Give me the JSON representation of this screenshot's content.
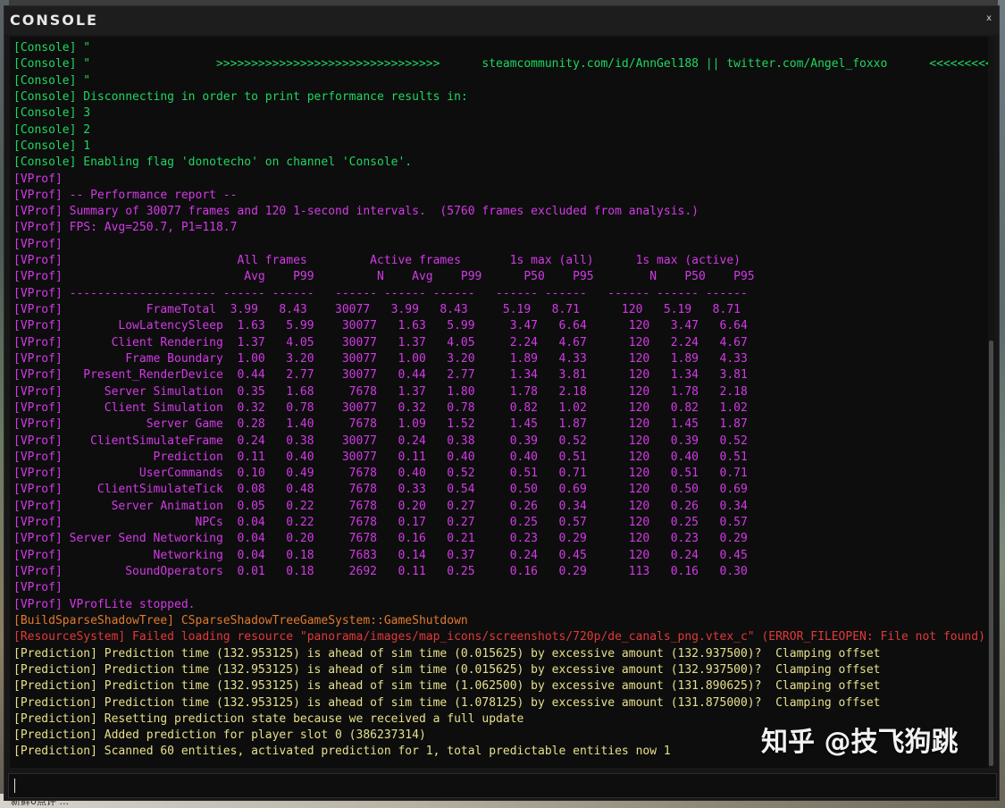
{
  "window": {
    "title": "CONSOLE",
    "close_glyph": "x"
  },
  "colors": {
    "console": "#1ed760",
    "vprof": "#d23ae6",
    "build": "#e07a2e",
    "resource": "#e03a3a",
    "prediction": "#e6e08a",
    "background": "#0d0d0d"
  },
  "log": {
    "lines": [
      {
        "channel": "console",
        "text": "[Console] \""
      },
      {
        "channel": "console",
        "text": "[Console] \"                  >>>>>>>>>>>>>>>>>>>>>>>>>>>>>>>>      steamcommunity.com/id/AnnGel188 || twitter.com/Angel_foxxo      <<<<<<<<<<<<<<<<<<<<<<<<<<<<<<<<<<"
      },
      {
        "channel": "console",
        "text": "[Console] \""
      },
      {
        "channel": "console",
        "text": "[Console] Disconnecting in order to print performance results in:"
      },
      {
        "channel": "console",
        "text": "[Console] 3"
      },
      {
        "channel": "console",
        "text": "[Console] 2"
      },
      {
        "channel": "console",
        "text": "[Console] 1"
      },
      {
        "channel": "console",
        "text": "[Console] Enabling flag 'donotecho' on channel 'Console'."
      },
      {
        "channel": "vprof",
        "text": "[VProf]"
      },
      {
        "channel": "vprof",
        "text": "[VProf] -- Performance report --"
      },
      {
        "channel": "vprof",
        "text": "[VProf] Summary of 30077 frames and 120 1-second intervals.  (5760 frames excluded from analysis.)"
      },
      {
        "channel": "vprof",
        "text": "[VProf] FPS: Avg=250.7, P1=118.7"
      },
      {
        "channel": "vprof",
        "text": "[VProf]"
      },
      {
        "channel": "vprof",
        "text": "[VProf]                         All frames         Active frames       1s max (all)      1s max (active)"
      },
      {
        "channel": "vprof",
        "text": "[VProf]                          Avg    P99         N    Avg    P99      P50    P95        N    P50    P95"
      },
      {
        "channel": "vprof",
        "text": "[VProf] --------------------- ------ ------   ------ ------ ------   ------ ------   ------ ------ ------"
      },
      {
        "channel": "vprof",
        "text": "[VProf]            FrameTotal  3.99   8.43    30077   3.99   8.43     5.19   8.71      120   5.19   8.71"
      },
      {
        "channel": "vprof",
        "text": "[VProf]        LowLatencySleep  1.63   5.99    30077   1.63   5.99     3.47   6.64      120   3.47   6.64"
      },
      {
        "channel": "vprof",
        "text": "[VProf]       Client Rendering  1.37   4.05    30077   1.37   4.05     2.24   4.67      120   2.24   4.67"
      },
      {
        "channel": "vprof",
        "text": "[VProf]         Frame Boundary  1.00   3.20    30077   1.00   3.20     1.89   4.33      120   1.89   4.33"
      },
      {
        "channel": "vprof",
        "text": "[VProf]   Present_RenderDevice  0.44   2.77    30077   0.44   2.77     1.34   3.81      120   1.34   3.81"
      },
      {
        "channel": "vprof",
        "text": "[VProf]      Server Simulation  0.35   1.68     7678   1.37   1.80     1.78   2.18      120   1.78   2.18"
      },
      {
        "channel": "vprof",
        "text": "[VProf]      Client Simulation  0.32   0.78    30077   0.32   0.78     0.82   1.02      120   0.82   1.02"
      },
      {
        "channel": "vprof",
        "text": "[VProf]            Server Game  0.28   1.40     7678   1.09   1.52     1.45   1.87      120   1.45   1.87"
      },
      {
        "channel": "vprof",
        "text": "[VProf]    ClientSimulateFrame  0.24   0.38    30077   0.24   0.38     0.39   0.52      120   0.39   0.52"
      },
      {
        "channel": "vprof",
        "text": "[VProf]             Prediction  0.11   0.40    30077   0.11   0.40     0.40   0.51      120   0.40   0.51"
      },
      {
        "channel": "vprof",
        "text": "[VProf]           UserCommands  0.10   0.49     7678   0.40   0.52     0.51   0.71      120   0.51   0.71"
      },
      {
        "channel": "vprof",
        "text": "[VProf]     ClientSimulateTick  0.08   0.48     7678   0.33   0.54     0.50   0.69      120   0.50   0.69"
      },
      {
        "channel": "vprof",
        "text": "[VProf]       Server Animation  0.05   0.22     7678   0.20   0.27     0.26   0.34      120   0.26   0.34"
      },
      {
        "channel": "vprof",
        "text": "[VProf]                   NPCs  0.04   0.22     7678   0.17   0.27     0.25   0.57      120   0.25   0.57"
      },
      {
        "channel": "vprof",
        "text": "[VProf] Server Send Networking  0.04   0.20     7678   0.16   0.21     0.23   0.29      120   0.23   0.29"
      },
      {
        "channel": "vprof",
        "text": "[VProf]             Networking  0.04   0.18     7683   0.14   0.37     0.24   0.45      120   0.24   0.45"
      },
      {
        "channel": "vprof",
        "text": "[VProf]         SoundOperators  0.01   0.18     2692   0.11   0.25     0.16   0.29      113   0.16   0.30"
      },
      {
        "channel": "vprof",
        "text": "[VProf]"
      },
      {
        "channel": "vprof",
        "text": "[VProf] VProfLite stopped."
      },
      {
        "channel": "build",
        "text": "[BuildSparseShadowTree] CSparseShadowTreeGameSystem::GameShutdown"
      },
      {
        "channel": "resource",
        "text": "[ResourceSystem] Failed loading resource \"panorama/images/map_icons/screenshots/720p/de_canals_png.vtex_c\" (ERROR_FILEOPEN: File not found)"
      },
      {
        "channel": "prediction",
        "text": "[Prediction] Prediction time (132.953125) is ahead of sim time (0.015625) by excessive amount (132.937500)?  Clamping offset"
      },
      {
        "channel": "prediction",
        "text": "[Prediction] Prediction time (132.953125) is ahead of sim time (0.015625) by excessive amount (132.937500)?  Clamping offset"
      },
      {
        "channel": "prediction",
        "text": "[Prediction] Prediction time (132.953125) is ahead of sim time (1.062500) by excessive amount (131.890625)?  Clamping offset"
      },
      {
        "channel": "prediction",
        "text": "[Prediction] Prediction time (132.953125) is ahead of sim time (1.078125) by excessive amount (131.875000)?  Clamping offset"
      },
      {
        "channel": "prediction",
        "text": "[Prediction] Resetting prediction state because we received a full update"
      },
      {
        "channel": "prediction",
        "text": "[Prediction] Added prediction for player slot 0 (386237314)"
      },
      {
        "channel": "prediction",
        "text": "[Prediction] Scanned 60 entities, activated prediction for 1, total predictable entities now 1"
      }
    ]
  },
  "watermark": "知乎 @技飞狗跳",
  "input": {
    "value": ""
  },
  "footer_text": "新鲜0点评 ..."
}
